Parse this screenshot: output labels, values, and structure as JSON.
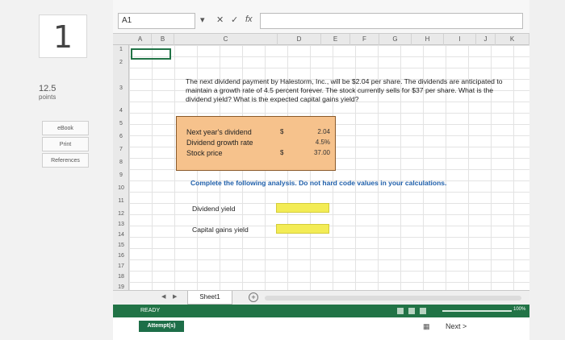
{
  "question_panel": {
    "number": "1",
    "points_value": "12.5",
    "points_label": "points",
    "buttons": [
      "eBook",
      "Print",
      "References"
    ]
  },
  "excel": {
    "name_box": "A1",
    "formula_icons": {
      "cancel": "✕",
      "enter": "✓",
      "fx": "fx"
    },
    "columns": [
      "A",
      "B",
      "C",
      "D",
      "E",
      "F",
      "G",
      "H",
      "I",
      "J",
      "K"
    ],
    "rows": [
      "1",
      "2",
      "3",
      "4",
      "5",
      "6",
      "7",
      "8",
      "9",
      "10",
      "11",
      "12",
      "13",
      "14",
      "15",
      "16",
      "17",
      "18",
      "19"
    ],
    "question": "The next dividend payment by Halestorm, Inc., will be $2.04 per share. The dividends are anticipated to maintain a growth rate of 4.5 percent forever. The stock currently sells for $37 per share. What is the dividend yield? What is the expected capital gains yield?",
    "inputs": [
      {
        "label": "Next year's dividend",
        "currency": "$",
        "value": "2.04"
      },
      {
        "label": "Dividend growth rate",
        "currency": "",
        "value": "4.5%"
      },
      {
        "label": "Stock price",
        "currency": "$",
        "value": "37.00"
      }
    ],
    "instruction": "Complete the following analysis. Do not hard code values in your calculations.",
    "analysis": [
      {
        "label": "Dividend yield"
      },
      {
        "label": "Capital gains yield"
      }
    ],
    "sheet_tab": "Sheet1",
    "add_sheet": "+",
    "status": "READY",
    "zoom": "100%"
  },
  "footer": {
    "attempts": "Attempt(s)",
    "next": "Next >"
  },
  "colors": {
    "excel_green": "#217346",
    "input_fill": "#f6c28c",
    "answer_fill": "#f3ec55",
    "instruction_text": "#1f5faa"
  }
}
